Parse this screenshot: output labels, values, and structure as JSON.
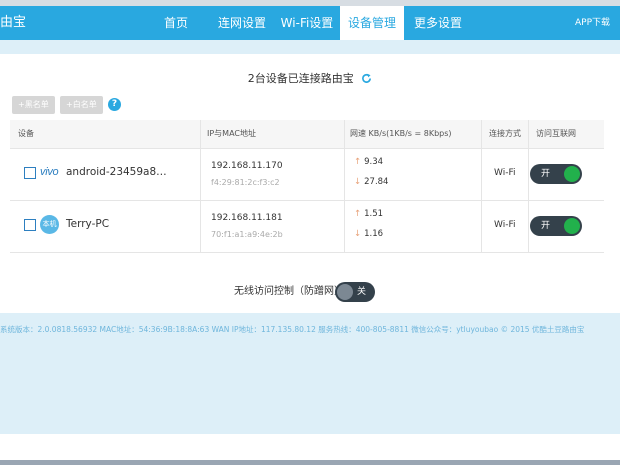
{
  "nav": {
    "brand": "由宝",
    "items": [
      "首页",
      "连网设置",
      "Wi-Fi设置",
      "设备管理",
      "更多设置"
    ],
    "active_index": 3,
    "app_download": "APP下载"
  },
  "status": {
    "text": "2台设备已连接路由宝"
  },
  "lists": {
    "blacklist": "+黑名单",
    "whitelist": "+白名单",
    "help": "?"
  },
  "table": {
    "headers": [
      "设备",
      "IP与MAC地址",
      "网速 KB/s(1KB/s = 8Kbps)",
      "连接方式",
      "访问互联网"
    ],
    "rows": [
      {
        "brand_logo": "vivo",
        "name": "android-23459a8…",
        "ip": "192.168.11.170",
        "mac": "f4:29:81:2c:f3:c2",
        "up_arrow": "↑",
        "up": "9.34",
        "down_arrow": "↓",
        "down": "27.84",
        "conn": "Wi-Fi",
        "access": "开"
      },
      {
        "brand_logo": "本机",
        "name": "Terry-PC",
        "ip": "192.168.11.181",
        "mac": "70:f1:a1:a9:4e:2b",
        "up_arrow": "↑",
        "up": "1.51",
        "down_arrow": "↓",
        "down": "1.16",
        "conn": "Wi-Fi",
        "access": "开"
      }
    ]
  },
  "wireless": {
    "label": "无线访问控制（防蹭网）",
    "state": "关"
  },
  "footer": {
    "text": "系统版本：2.0.0818.56932   MAC地址：54:36:9B:18:8A:63   WAN IP地址：117.135.80.12   服务热线：400-805-8811   微信公众号：ytluyoubao  © 2015 优酷土豆路由宝"
  },
  "colors": {
    "accent": "#29a8e0",
    "toggle_on_knob": "#22b14c",
    "toggle_dark": "#34414b",
    "footer_bg": "#ddeff8"
  }
}
